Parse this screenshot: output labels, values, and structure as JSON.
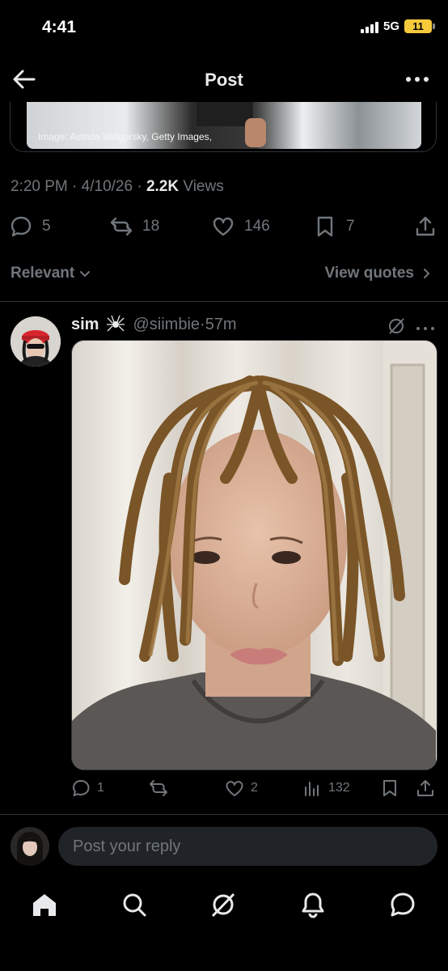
{
  "status_bar": {
    "time": "4:41",
    "network": "5G",
    "battery": "11"
  },
  "header": {
    "title": "Post"
  },
  "quoted": {
    "caption": "Image: Astrida Valigorsky, Getty Images,"
  },
  "meta": {
    "time": "2:20 PM",
    "date": "4/10/26",
    "views_count": "2.2K",
    "views_label": "Views"
  },
  "post_actions": {
    "replies": "5",
    "reposts": "18",
    "likes": "146",
    "bookmarks": "7"
  },
  "sort": {
    "label": "Relevant",
    "view_quotes": "View quotes"
  },
  "reply": {
    "name": "sim",
    "handle": "@siimbie",
    "time": "57m",
    "replies": "1",
    "likes": "2",
    "views": "132"
  },
  "composer": {
    "placeholder": "Post your reply"
  },
  "nav": [
    "home-icon",
    "search-icon",
    "grok-icon",
    "notifications-icon",
    "messages-icon"
  ],
  "colors": {
    "background": "#000000",
    "text": "#e7e9ea",
    "muted": "#71767b",
    "border": "#2f3336",
    "input_bg": "#202327"
  }
}
